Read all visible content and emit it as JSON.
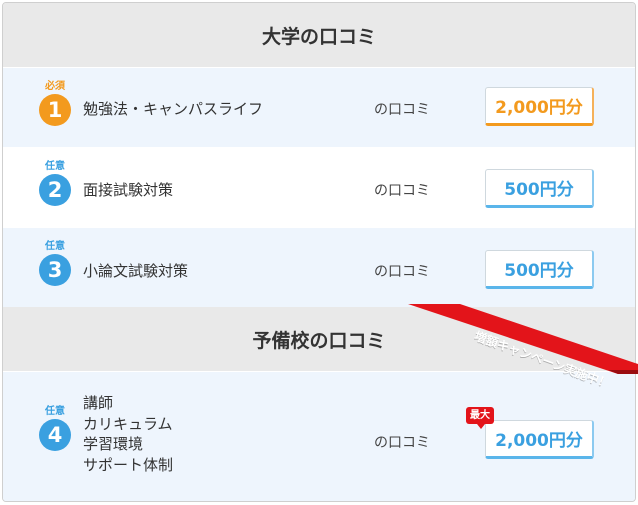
{
  "sections": {
    "university": {
      "title": "大学の口コミ"
    },
    "prep_school": {
      "title": "予備校の口コミ"
    }
  },
  "items": [
    {
      "tag": "必須",
      "number": "1",
      "title": "勉強法・キャンパスライフ",
      "suffix": "の口コミ",
      "reward": "2,000円分"
    },
    {
      "tag": "任意",
      "number": "2",
      "title": "面接試験対策",
      "suffix": "の口コミ",
      "reward": "500円分"
    },
    {
      "tag": "任意",
      "number": "3",
      "title": "小論文試験対策",
      "suffix": "の口コミ",
      "reward": "500円分"
    },
    {
      "tag": "任意",
      "number": "4",
      "title_lines": [
        "講師",
        "カリキュラム",
        "学習環境",
        "サポート体制"
      ],
      "suffix": "の口コミ",
      "reward": "2,000円分",
      "flag": "最大"
    }
  ],
  "campaign_ribbon": "増額キャンペーン実施中！",
  "colors": {
    "required_orange": "#f39a1e",
    "optional_blue": "#3aa0e0",
    "ribbon_red": "#e3141a",
    "row_blue": "#eef5fd",
    "header_gray": "#e9e9e9"
  }
}
